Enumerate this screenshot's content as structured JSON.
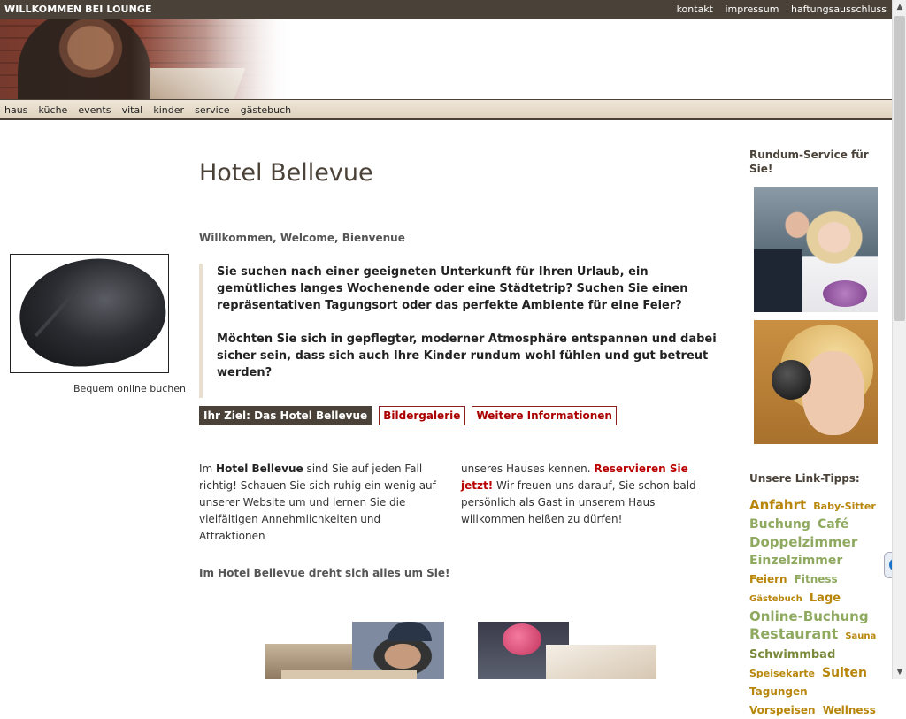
{
  "topbar": {
    "title": "WILLKOMMEN BEI LOUNGE",
    "links": [
      "kontakt",
      "impressum",
      "haftungsausschluss"
    ]
  },
  "nav": [
    "haus",
    "küche",
    "events",
    "vital",
    "kinder",
    "service",
    "gästebuch"
  ],
  "left": {
    "caption": "Bequem online buchen"
  },
  "main": {
    "title": "Hotel Bellevue",
    "greeting": "Willkommen, Welcome, Bienvenue",
    "intro": [
      "Sie suchen nach einer geeigneten Unterkunft für Ihren Urlaub, ein gemütliches langes Wochenende oder eine Städtetrip? Suchen Sie einen repräsentativen Tagungsort oder das perfekte Ambiente für eine Feier?",
      "Möchten Sie sich in gepflegter, moderner Atmosphäre entspannen und dabei sicher sein, dass sich auch Ihre Kinder rundum wohl fühlen und gut betreut werden?"
    ],
    "tabs": [
      {
        "label": "Ihr Ziel: Das Hotel Bellevue",
        "active": true
      },
      {
        "label": "Bildergalerie",
        "active": false
      },
      {
        "label": "Weitere Informationen",
        "active": false
      }
    ],
    "col1": {
      "pre": "Im ",
      "bold": "Hotel Bellevue",
      "post": " sind Sie auf jeden Fall richtig! Schauen Sie sich ruhig ein wenig auf unserer Website um und lernen Sie die vielfältigen Annehmlichkeiten und Attraktionen"
    },
    "col2": {
      "pre": "unseres Hauses kennen. ",
      "link": "Reservieren Sie jetzt!",
      "post": " Wir freuen uns darauf, Sie schon bald persönlich als Gast in unserem Haus willkommen heißen zu dürfen!"
    },
    "tagline": "Im Hotel Bellevue dreht sich alles um Sie!"
  },
  "right": {
    "heading": "Rundum-Service für Sie!",
    "links_heading": "Unsere Link-Tipps:",
    "tags": [
      {
        "label": "Anfahrt",
        "size": 15,
        "color": "gold"
      },
      {
        "label": "Baby-Sitter",
        "size": 11,
        "color": "gold"
      },
      {
        "label": "Buchung",
        "size": 14,
        "color": "green"
      },
      {
        "label": "Café",
        "size": 14,
        "color": "green"
      },
      {
        "label": "Doppelzimmer",
        "size": 15,
        "color": "green"
      },
      {
        "label": "Einzelzimmer",
        "size": 14,
        "color": "green"
      },
      {
        "label": "Feiern",
        "size": 12,
        "color": "gold"
      },
      {
        "label": "Fitness",
        "size": 12,
        "color": "green"
      },
      {
        "label": "Gästebuch",
        "size": 10,
        "color": "gold"
      },
      {
        "label": "Lage",
        "size": 13,
        "color": "gold"
      },
      {
        "label": "Online-Buchung",
        "size": 15,
        "color": "green"
      },
      {
        "label": "Restaurant",
        "size": 16,
        "color": "green"
      },
      {
        "label": "Sauna",
        "size": 10,
        "color": "gold"
      },
      {
        "label": "Schwimmbad",
        "size": 13,
        "color": "olive"
      },
      {
        "label": "Speisekarte",
        "size": 11,
        "color": "gold"
      },
      {
        "label": "Suiten",
        "size": 14,
        "color": "gold"
      },
      {
        "label": "Tagungen",
        "size": 12,
        "color": "gold"
      },
      {
        "label": "Vorspeisen",
        "size": 12,
        "color": "gold"
      },
      {
        "label": "Wellness",
        "size": 12,
        "color": "gold"
      }
    ]
  },
  "colors": {
    "brand_dark": "#4a4238",
    "link_red": "#b00000",
    "tag_green": "#8faa60",
    "tag_gold": "#b8860b"
  },
  "icons": [
    "teamviewer-icon",
    "scroll-up-icon",
    "scroll-down-icon"
  ]
}
